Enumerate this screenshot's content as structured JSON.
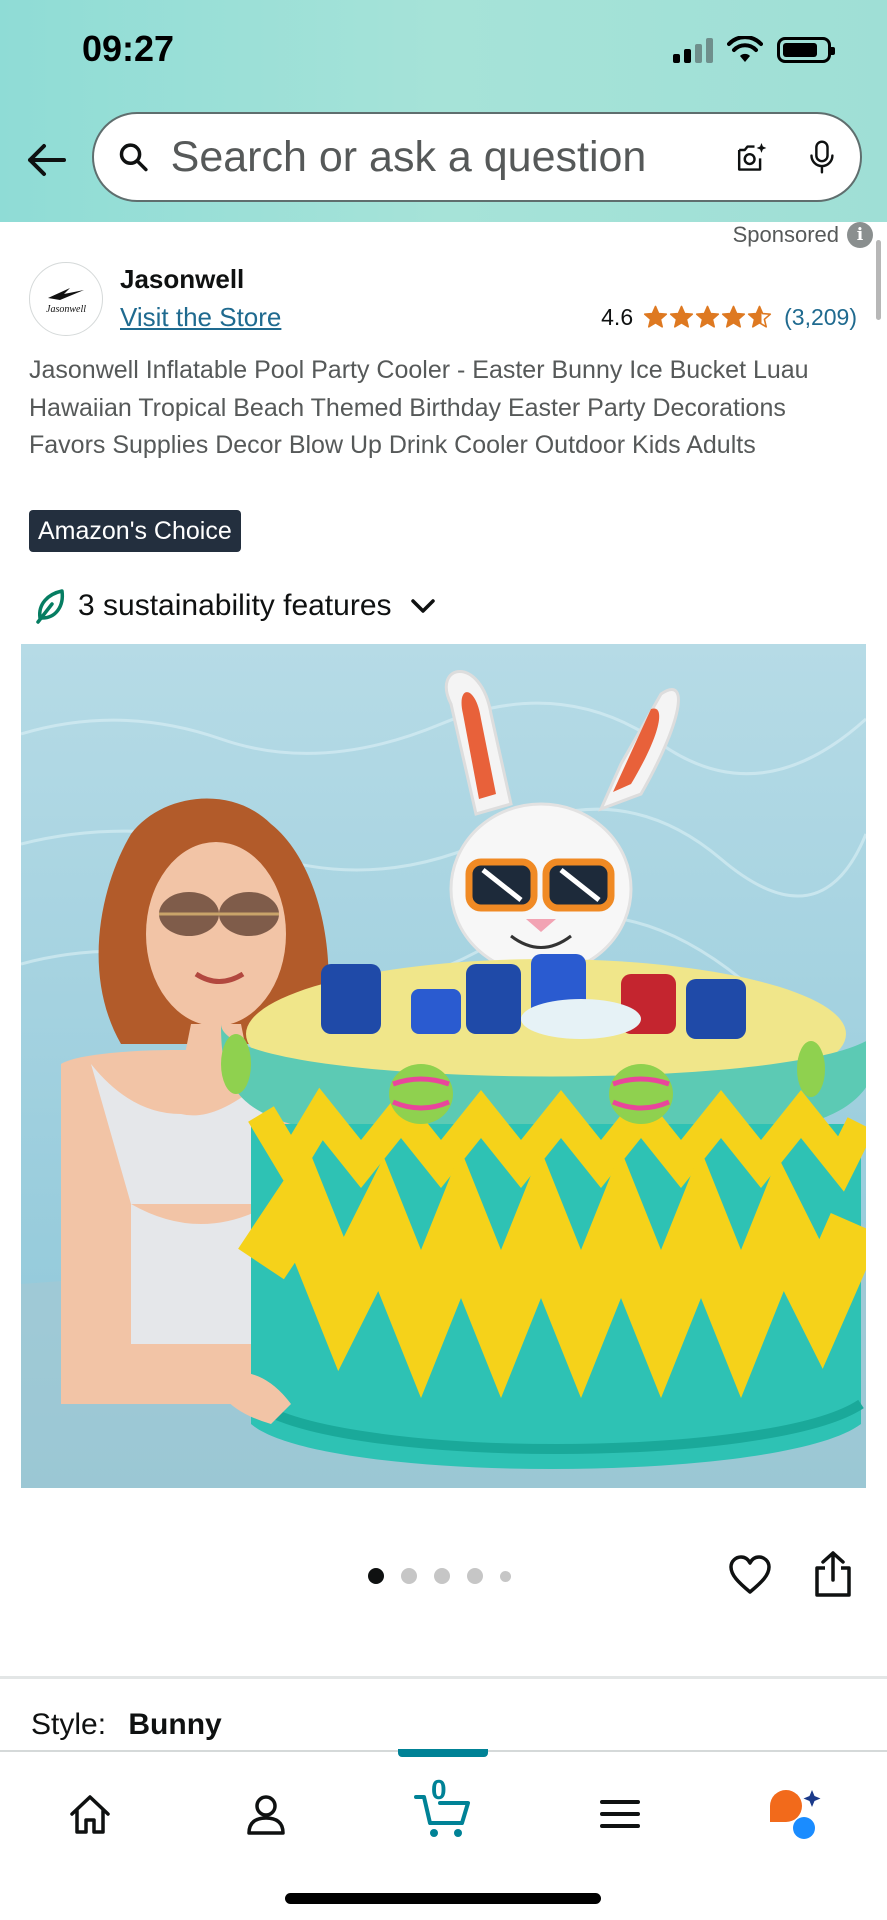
{
  "status_bar": {
    "time": "09:27"
  },
  "search": {
    "placeholder": "Search or ask a question"
  },
  "sponsored": {
    "label": "Sponsored"
  },
  "brand": {
    "logo_text": "Jasonwell",
    "name": "Jasonwell",
    "visit_store": "Visit the Store"
  },
  "rating": {
    "value": "4.6",
    "stars": 4.6,
    "count": "(3,209)"
  },
  "product": {
    "title": "Jasonwell Inflatable Pool Party Cooler - Easter Bunny Ice Bucket Luau Hawaiian Tropical Beach Themed Birthday Easter Party Decorations Favors Supplies Decor Blow Up Drink Cooler Outdoor Kids Adults",
    "badge": "Amazon's Choice",
    "sustainability": "3 sustainability features",
    "image_count": 5,
    "active_image": 1
  },
  "style": {
    "label": "Style:",
    "value": "Bunny"
  },
  "cart": {
    "count": "0"
  },
  "colors": {
    "link": "#1f6a8f",
    "star": "#de7921",
    "badge_bg": "#232f3e",
    "accent_teal": "#008296",
    "header_gradient": "#9fdfd6"
  },
  "icons": [
    "back-arrow-icon",
    "search-icon",
    "camera-icon",
    "mic-icon",
    "info-icon",
    "leaf-icon",
    "chevron-down-icon",
    "heart-icon",
    "share-icon",
    "home-icon",
    "account-icon",
    "cart-icon",
    "menu-icon",
    "rufus-icon"
  ]
}
